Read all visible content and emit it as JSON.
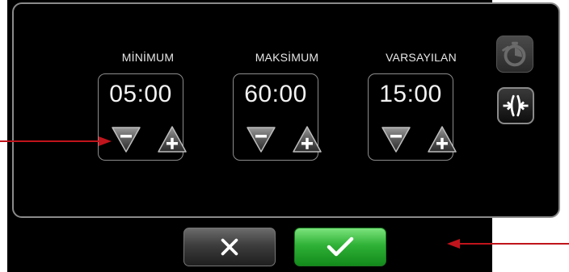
{
  "columns": [
    {
      "label": "MİNİMUM",
      "value": "05:00"
    },
    {
      "label": "MAKSİMUM",
      "value": "60:00"
    },
    {
      "label": "VARSAYILAN",
      "value": "15:00"
    }
  ],
  "side_buttons": {
    "timer": "stopwatch-icon",
    "compress": "compress-icon"
  },
  "colors": {
    "accent_green": "#2fb136",
    "annotation_red": "#c0141c",
    "panel_border": "#8a8a8a"
  }
}
